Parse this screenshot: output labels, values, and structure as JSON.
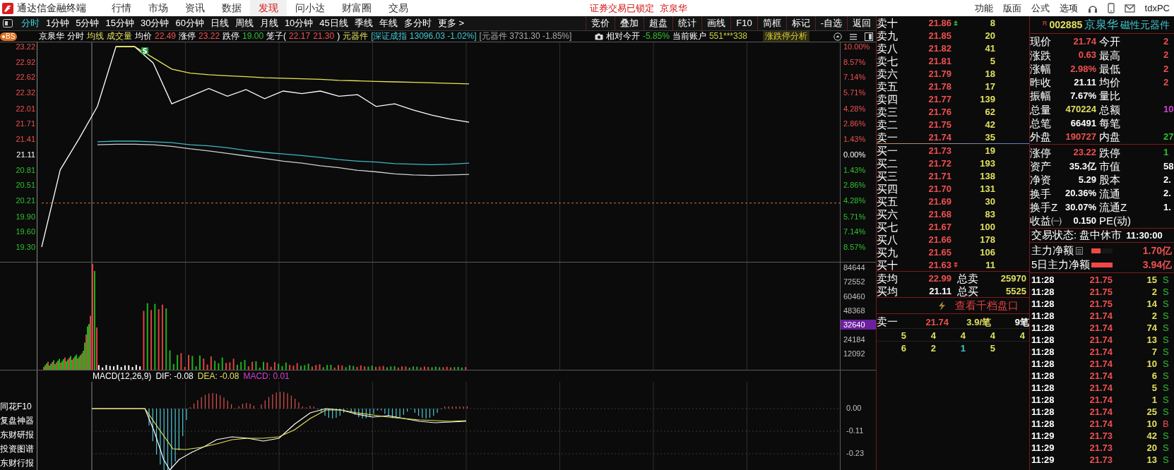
{
  "menu_bar": {
    "app_title": "通达信金融终端",
    "items": [
      {
        "label": "行情",
        "selected": false
      },
      {
        "label": "市场",
        "selected": false
      },
      {
        "label": "资讯",
        "selected": false
      },
      {
        "label": "数据",
        "selected": false
      },
      {
        "label": "发现",
        "selected": true
      },
      {
        "label": "问小达",
        "selected": false
      },
      {
        "label": "财富圈",
        "selected": false
      },
      {
        "label": "交易",
        "selected": false
      }
    ],
    "notice": "证券交易已锁定",
    "notice_stock": "京泉华",
    "right_items": [
      "功能",
      "版面",
      "公式",
      "选项"
    ],
    "user": "tdxPC"
  },
  "period_tabs": [
    {
      "label": "分时",
      "selected": true
    },
    {
      "label": "1分钟",
      "selected": false
    },
    {
      "label": "5分钟",
      "selected": false
    },
    {
      "label": "15分钟",
      "selected": false
    },
    {
      "label": "30分钟",
      "selected": false
    },
    {
      "label": "60分钟",
      "selected": false
    },
    {
      "label": "日线",
      "selected": false
    },
    {
      "label": "周线",
      "selected": false
    },
    {
      "label": "月线",
      "selected": false
    },
    {
      "label": "10分钟",
      "selected": false
    },
    {
      "label": "45日线",
      "selected": false
    },
    {
      "label": "季线",
      "selected": false
    },
    {
      "label": "年线",
      "selected": false
    },
    {
      "label": "多分时",
      "selected": false
    },
    {
      "label": "更多 >",
      "selected": false
    }
  ],
  "toolbar": [
    "竞价",
    "叠加",
    "超盘",
    "统计",
    "画线",
    "F10",
    "简框",
    "标记",
    "-自选",
    "返回"
  ],
  "chart_header": {
    "badge": "BS",
    "items": [
      {
        "text": "京泉华",
        "kind": "label"
      },
      {
        "text": "分时",
        "kind": "label"
      },
      {
        "text": "均线",
        "kind": "yellow"
      },
      {
        "text": "成交量",
        "kind": "yellow"
      },
      {
        "text": "均价",
        "kind": "label"
      },
      {
        "text": "22.49",
        "kind": "up"
      },
      {
        "text": "涨停",
        "kind": "label"
      },
      {
        "text": "23.22",
        "kind": "up"
      },
      {
        "text": "跌停",
        "kind": "label"
      },
      {
        "text": "19.00",
        "kind": "down"
      },
      {
        "text": "笼子(",
        "kind": "label"
      },
      {
        "text": "22.17",
        "kind": "up"
      },
      {
        "text": "21.30",
        "kind": "up"
      },
      {
        "text": ")",
        "kind": "label"
      },
      {
        "text": "元器件",
        "kind": "yellow"
      },
      {
        "text": "[深证成指 13096.03 -1.02%]",
        "kind": "cyan"
      },
      {
        "text": "[元器件 3731.30 -1.85%]",
        "kind": "muted"
      }
    ],
    "right_items": [
      {
        "text": "相对今开",
        "kind": "label"
      },
      {
        "text": "-5.85%",
        "kind": "down"
      },
      {
        "text": "当前账户",
        "kind": "label"
      },
      {
        "text": "551***338",
        "kind": "gold"
      }
    ],
    "analysis_button": "涨跌停分析"
  },
  "price_chart": {
    "chart_data": {
      "type": "line",
      "categories": [
        null,
        null,
        null,
        null,
        null,
        null,
        null,
        null,
        null,
        null,
        null,
        null,
        null,
        null,
        null,
        null,
        null,
        null,
        null,
        null,
        null,
        null,
        null,
        null,
        null,
        null,
        null,
        null,
        null,
        null,
        null,
        null,
        null,
        null,
        null,
        null,
        null,
        null,
        null,
        null,
        null,
        null,
        null,
        null
      ],
      "series": [
        {
          "color": "#ffffff",
          "values": [
            19.3,
            20.81,
            21.41,
            22.05,
            23.22,
            23.22,
            22.9,
            22.1,
            22.25,
            22.4,
            22.25,
            22.38,
            22.2,
            22.35,
            22.3,
            22.35,
            22.25,
            22.28,
            22.05,
            22.1,
            21.98,
            21.88,
            21.8,
            21.74,
            null,
            null,
            null,
            null,
            null,
            null,
            null,
            null,
            null,
            null,
            null,
            null,
            null,
            null,
            null,
            null,
            null,
            null,
            null,
            null
          ]
        },
        {
          "color": "#e6e65a",
          "values": [
            null,
            null,
            null,
            null,
            23.22,
            23.22,
            23.0,
            22.78,
            22.7,
            22.67,
            22.65,
            22.63,
            22.61,
            22.6,
            22.59,
            22.58,
            22.56,
            22.55,
            22.54,
            22.53,
            22.52,
            22.51,
            22.5,
            22.49,
            null,
            null,
            null,
            null,
            null,
            null,
            null,
            null,
            null,
            null,
            null,
            null,
            null,
            null,
            null,
            null,
            null,
            null,
            null,
            null
          ]
        },
        {
          "color": "#3fb8c0",
          "values": [
            null,
            null,
            null,
            21.36,
            21.37,
            21.37,
            21.36,
            21.34,
            21.3,
            21.28,
            21.24,
            21.19,
            21.15,
            21.12,
            21.09,
            21.05,
            21.01,
            20.98,
            20.96,
            20.93,
            20.92,
            20.91,
            20.92,
            20.94,
            null,
            null,
            null,
            null,
            null,
            null,
            null,
            null,
            null,
            null,
            null,
            null,
            null,
            null,
            null,
            null,
            null,
            null,
            null,
            null
          ]
        },
        {
          "color": "#d07a30",
          "line_style": "dashed",
          "values": [
            20.16,
            20.16,
            20.16,
            20.16,
            20.16,
            20.16,
            20.16,
            20.16,
            20.16,
            20.16,
            20.16,
            20.16,
            20.16,
            20.16,
            20.16,
            20.16,
            20.16,
            20.16,
            20.16,
            20.16,
            20.16,
            20.16,
            20.16,
            20.16,
            20.16,
            20.16,
            20.16,
            20.16,
            20.16,
            20.16,
            20.16,
            20.16,
            20.16,
            20.16,
            20.16,
            20.16,
            20.16,
            20.16,
            20.16,
            20.16,
            20.16,
            20.16,
            20.16,
            20.16
          ]
        },
        {
          "color": "#d0d0d0",
          "values": [
            null,
            null,
            null,
            21.3,
            21.31,
            21.31,
            21.3,
            21.27,
            21.22,
            21.18,
            21.13,
            21.08,
            21.03,
            20.98,
            20.94,
            20.89,
            20.85,
            20.8,
            20.77,
            20.73,
            20.71,
            20.7,
            20.71,
            20.72,
            null,
            null,
            null,
            null,
            null,
            null,
            null,
            null,
            null,
            null,
            null,
            null,
            null,
            null,
            null,
            null,
            null,
            null,
            null,
            null
          ]
        }
      ],
      "ylim": [
        19.3,
        23.22
      ],
      "yticks": [
        {
          "value": 23.22,
          "label": "23.22"
        },
        {
          "value": 22.92,
          "label": "22.92"
        },
        {
          "value": 22.62,
          "label": "22.62"
        },
        {
          "value": 22.32,
          "label": "22.32"
        },
        {
          "value": 22.01,
          "label": "22.01"
        },
        {
          "value": 21.71,
          "label": "21.71"
        },
        {
          "value": 21.41,
          "label": "21.41"
        },
        {
          "value": 21.11,
          "label": "21.11"
        },
        {
          "value": 20.81,
          "label": "20.81"
        },
        {
          "value": 20.51,
          "label": "20.51"
        },
        {
          "value": 20.21,
          "label": "20.21"
        },
        {
          "value": 19.9,
          "label": "19.90"
        },
        {
          "value": 19.6,
          "label": "19.60"
        },
        {
          "value": 19.3,
          "label": "19.30"
        }
      ],
      "grid": true
    },
    "signal_badge": "S",
    "percent_axis": [
      {
        "text": "10.00%",
        "kind": "up"
      },
      {
        "text": "8.57%",
        "kind": "up"
      },
      {
        "text": "7.14%",
        "kind": "up"
      },
      {
        "text": "5.71%",
        "kind": "up"
      },
      {
        "text": "4.28%",
        "kind": "up"
      },
      {
        "text": "2.86%",
        "kind": "up"
      },
      {
        "text": "1.43%",
        "kind": "up"
      },
      {
        "text": "0.00%",
        "kind": "flat"
      },
      {
        "text": "1.43%",
        "kind": "down"
      },
      {
        "text": "2.86%",
        "kind": "down"
      },
      {
        "text": "4.28%",
        "kind": "down"
      },
      {
        "text": "5.71%",
        "kind": "down"
      },
      {
        "text": "7.14%",
        "kind": "down"
      },
      {
        "text": "8.57%",
        "kind": "down"
      }
    ]
  },
  "volume_axis": [
    {
      "text": "84644",
      "kind": "plain"
    },
    {
      "text": "72552",
      "kind": "plain"
    },
    {
      "text": "60460",
      "kind": "plain"
    },
    {
      "text": "48368",
      "kind": "plain"
    },
    {
      "text": "32640",
      "kind": "highlight"
    },
    {
      "text": "24184",
      "kind": "plain"
    },
    {
      "text": "12092",
      "kind": "plain"
    }
  ],
  "macd": {
    "legend": [
      {
        "text": "MACD(12,26,9)",
        "kind": "label"
      },
      {
        "text": "DIF: -0.08",
        "kind": "label"
      },
      {
        "text": "DEA: -0.08",
        "kind": "yellow"
      },
      {
        "text": "MACD: 0.01",
        "kind": "purple"
      }
    ],
    "axis": [
      "0.00",
      "-0.11",
      "-0.23"
    ]
  },
  "sidebar": [
    "同花F10",
    "复盘神器",
    "东财研报",
    "投资图谱",
    "东财行报"
  ],
  "order_book": {
    "asks": [
      {
        "label": "卖十",
        "price": "21.86",
        "volume": "8",
        "kind": "arrow_up"
      },
      {
        "label": "卖九",
        "price": "21.85",
        "volume": "20",
        "kind": "plain"
      },
      {
        "label": "卖八",
        "price": "21.82",
        "volume": "41",
        "kind": "plain"
      },
      {
        "label": "卖七",
        "price": "21.81",
        "volume": "5",
        "kind": "plain"
      },
      {
        "label": "卖六",
        "price": "21.79",
        "volume": "18",
        "kind": "plain"
      },
      {
        "label": "卖五",
        "price": "21.78",
        "volume": "17",
        "kind": "plain"
      },
      {
        "label": "卖四",
        "price": "21.77",
        "volume": "139",
        "kind": "plain"
      },
      {
        "label": "卖三",
        "price": "21.76",
        "volume": "62",
        "kind": "plain"
      },
      {
        "label": "卖二",
        "price": "21.75",
        "volume": "42",
        "kind": "plain"
      },
      {
        "label": "卖一",
        "price": "21.74",
        "volume": "35",
        "kind": "plain"
      }
    ],
    "bids": [
      {
        "label": "买一",
        "price": "21.73",
        "volume": "19",
        "kind": "plain"
      },
      {
        "label": "买二",
        "price": "21.72",
        "volume": "193",
        "kind": "plain"
      },
      {
        "label": "买三",
        "price": "21.71",
        "volume": "138",
        "kind": "plain"
      },
      {
        "label": "买四",
        "price": "21.70",
        "volume": "131",
        "kind": "plain"
      },
      {
        "label": "买五",
        "price": "21.69",
        "volume": "30",
        "kind": "plain"
      },
      {
        "label": "买六",
        "price": "21.68",
        "volume": "83",
        "kind": "plain"
      },
      {
        "label": "买七",
        "price": "21.67",
        "volume": "100",
        "kind": "plain"
      },
      {
        "label": "买八",
        "price": "21.66",
        "volume": "178",
        "kind": "plain"
      },
      {
        "label": "买九",
        "price": "21.65",
        "volume": "106",
        "kind": "plain"
      },
      {
        "label": "买十",
        "price": "21.63",
        "volume": "11",
        "kind": "arrow_down"
      }
    ],
    "summary": [
      {
        "label": "卖均",
        "value": "22.99",
        "kind": "up",
        "total_label": "总卖",
        "total": "25970"
      },
      {
        "label": "买均",
        "value": "21.11",
        "kind": "flat",
        "total_label": "总买",
        "total": "5525"
      }
    ],
    "link": "查看千档盘口",
    "queue": {
      "label": "卖一",
      "price": "21.74",
      "per_trade": "3.9/笔",
      "count": "9笔",
      "rows": [
        [
          {
            "text": "5",
            "kind": "yellow"
          },
          {
            "text": "4",
            "kind": "yellow"
          },
          {
            "text": "4",
            "kind": "yellow"
          },
          {
            "text": "4",
            "kind": "yellow"
          },
          {
            "text": "4",
            "kind": "yellow"
          }
        ],
        [
          {
            "text": "6",
            "kind": "yellow"
          },
          {
            "text": "2",
            "kind": "yellow"
          },
          {
            "text": "1",
            "kind": "cyan"
          },
          {
            "text": "5",
            "kind": "yellow"
          }
        ]
      ]
    }
  },
  "quote": {
    "flag": "R",
    "code": "002885",
    "name": "京泉华",
    "industry": "磁性元器件",
    "groups": [
      [
        [
          {
            "label": "现价",
            "value": "21.74",
            "kind": "up"
          },
          {
            "label": "今开",
            "value": "2",
            "kind": "up"
          }
        ],
        [
          {
            "label": "涨跌",
            "value": "0.63",
            "kind": "up"
          },
          {
            "label": "最高",
            "value": "2",
            "kind": "up"
          }
        ],
        [
          {
            "label": "涨幅",
            "value": "2.98%",
            "kind": "up"
          },
          {
            "label": "最低",
            "value": "2",
            "kind": "up"
          }
        ],
        [
          {
            "label": "昨收",
            "value": "21.11",
            "kind": "flat"
          },
          {
            "label": "均价",
            "value": "2",
            "kind": "up"
          }
        ],
        [
          {
            "label": "振幅",
            "value": "7.67%",
            "kind": "flat"
          },
          {
            "label": "量比"
          }
        ],
        [
          {
            "label": "总量",
            "value": "470224",
            "kind": "yellow"
          },
          {
            "label": "总额",
            "value": "10",
            "kind": "purple"
          }
        ],
        [
          {
            "label": "总笔",
            "value": "66491",
            "kind": "flat"
          },
          {
            "label": "每笔"
          }
        ],
        [
          {
            "label": "外盘",
            "value": "190727",
            "kind": "up"
          },
          {
            "label": "内盘",
            "value": "27",
            "kind": "down"
          }
        ]
      ],
      [
        [
          {
            "label": "涨停",
            "value": "23.22",
            "kind": "up"
          },
          {
            "label": "跌停",
            "value": "1",
            "kind": "down"
          }
        ],
        [
          {
            "label": "资产",
            "value": "35.3亿",
            "kind": "flat"
          },
          {
            "label": "市值",
            "value": "58",
            "kind": "flat"
          }
        ],
        [
          {
            "label": "净资",
            "value": "5.29",
            "kind": "flat"
          },
          {
            "label": "股本",
            "value": "2.",
            "kind": "flat"
          }
        ],
        [
          {
            "label": "换手",
            "value": "20.36%",
            "kind": "flat"
          },
          {
            "label": "流通",
            "value": "2.",
            "kind": "flat"
          }
        ],
        [
          {
            "label": "换手Z",
            "value": "30.07%",
            "kind": "flat"
          },
          {
            "label": "流通Z",
            "value": "1.",
            "kind": "flat"
          }
        ],
        [
          {
            "label": "收益㈠",
            "value": "0.150",
            "kind": "flat"
          },
          {
            "label": "PE(动)"
          }
        ]
      ]
    ],
    "status": "交易状态: 盘中休市",
    "status_time": "11:30:00",
    "fund_flow": [
      {
        "label": "主力净额",
        "has_icon": true,
        "level": 0.43,
        "value": "1.70亿"
      },
      {
        "label": "5日主力净额",
        "has_icon": false,
        "level": 1,
        "value": "3.94亿"
      }
    ],
    "ticks": [
      {
        "time": "11:28",
        "price": "21.75",
        "volume": "15",
        "side": "S",
        "kind": "sell"
      },
      {
        "time": "11:28",
        "price": "21.75",
        "volume": "2",
        "side": "S",
        "kind": "sell"
      },
      {
        "time": "11:28",
        "price": "21.75",
        "volume": "14",
        "side": "S",
        "kind": "sell"
      },
      {
        "time": "11:28",
        "price": "21.74",
        "volume": "2",
        "side": "S",
        "kind": "sell"
      },
      {
        "time": "11:28",
        "price": "21.74",
        "volume": "74",
        "side": "S",
        "kind": "sell"
      },
      {
        "time": "11:28",
        "price": "21.74",
        "volume": "13",
        "side": "S",
        "kind": "sell"
      },
      {
        "time": "11:28",
        "price": "21.74",
        "volume": "7",
        "side": "S",
        "kind": "sell"
      },
      {
        "time": "11:28",
        "price": "21.74",
        "volume": "10",
        "side": "S",
        "kind": "sell"
      },
      {
        "time": "11:28",
        "price": "21.74",
        "volume": "6",
        "side": "S",
        "kind": "sell"
      },
      {
        "time": "11:28",
        "price": "21.74",
        "volume": "5",
        "side": "S",
        "kind": "sell"
      },
      {
        "time": "11:28",
        "price": "21.74",
        "volume": "1",
        "side": "S",
        "kind": "sell"
      },
      {
        "time": "11:28",
        "price": "21.74",
        "volume": "25",
        "side": "S",
        "kind": "sell"
      },
      {
        "time": "11:28",
        "price": "21.74",
        "volume": "10",
        "side": "B",
        "kind": "buy"
      },
      {
        "time": "11:29",
        "price": "21.73",
        "volume": "42",
        "side": "S",
        "kind": "sell"
      },
      {
        "time": "11:29",
        "price": "21.73",
        "volume": "20",
        "side": "S",
        "kind": "sell"
      },
      {
        "time": "11:29",
        "price": "21.73",
        "volume": "13",
        "side": "S",
        "kind": "sell"
      }
    ]
  }
}
